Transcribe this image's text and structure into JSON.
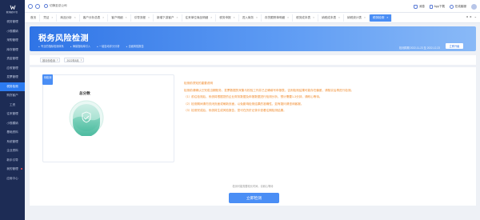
{
  "brand": {
    "name": "税务服务平台"
  },
  "sidebar": {
    "items": [
      {
        "label": "税务管理"
      },
      {
        "label": "小规模纳"
      },
      {
        "label": "采购管理"
      },
      {
        "label": "库存管理"
      },
      {
        "label": "资金管理"
      },
      {
        "label": "应收管理"
      },
      {
        "label": "发票管理"
      },
      {
        "label": "税务检测",
        "active": true
      },
      {
        "label": "购货客户"
      },
      {
        "label": "工资"
      },
      {
        "label": "往来管理"
      },
      {
        "label": "小规模纳"
      },
      {
        "label": "基础资料"
      },
      {
        "label": "系统管理"
      },
      {
        "label": "企业资料"
      },
      {
        "label": "新手引导"
      },
      {
        "label": "我的管理",
        "dot": true
      },
      {
        "label": "应用中心"
      }
    ]
  },
  "topnav": {
    "switch_label": "切换至总公司"
  },
  "topright": {
    "msg": "消息",
    "app": "App下载",
    "help": "在线客服"
  },
  "tabs": [
    {
      "label": "首页"
    },
    {
      "label": "凭证"
    },
    {
      "label": "商品分析"
    },
    {
      "label": "客户分析总表"
    },
    {
      "label": "客户明细"
    },
    {
      "label": "引导流程"
    },
    {
      "label": "新增下游客户"
    },
    {
      "label": "往来单位商品明细"
    },
    {
      "label": "税务申报"
    },
    {
      "label": "进入商务"
    },
    {
      "label": "存货跟踪单明细"
    },
    {
      "label": "税务成本表"
    },
    {
      "label": "纳税成本表"
    },
    {
      "label": "纳税统计表"
    },
    {
      "label": "税务检测",
      "active": true
    }
  ],
  "banner": {
    "title": "税务风险检测",
    "features": [
      "专业的指标检测体系",
      "海量指标库引入",
      "一键自动评分分析",
      "全面风险报告"
    ],
    "period": "检测周期 2022-11-23 至 2022-12-23",
    "upgrade_label": "立即升级"
  },
  "filters": {
    "type": "按月份检测",
    "month": "2022年8月"
  },
  "score": {
    "flag": "待检测",
    "label": "总分数"
  },
  "description": {
    "lines": [
      "检测前须知的重要说明",
      "检测前请确认已完成当期账务、发票数据的采集与校验工作并已正确填写申报表，否则检测结果可能存在偏差，请核实后再进行检测。",
      "（1）前往检测后，系统将根据您的企业财务数据及申报数据进行检测分析，预计需要1-3分钟，请耐心等待。",
      "（2）检测期间请勿关闭页面或刷新页面，以免影响检测结果的准确性，如有疑问请咨询客服。",
      "（3）检测完成后，系统将生成风险报告，您可在历史记录中查看往期检测结果。"
    ]
  },
  "action": {
    "tip": "检测可能需要较长时间，请耐心等待",
    "start_label": "立即检测"
  }
}
